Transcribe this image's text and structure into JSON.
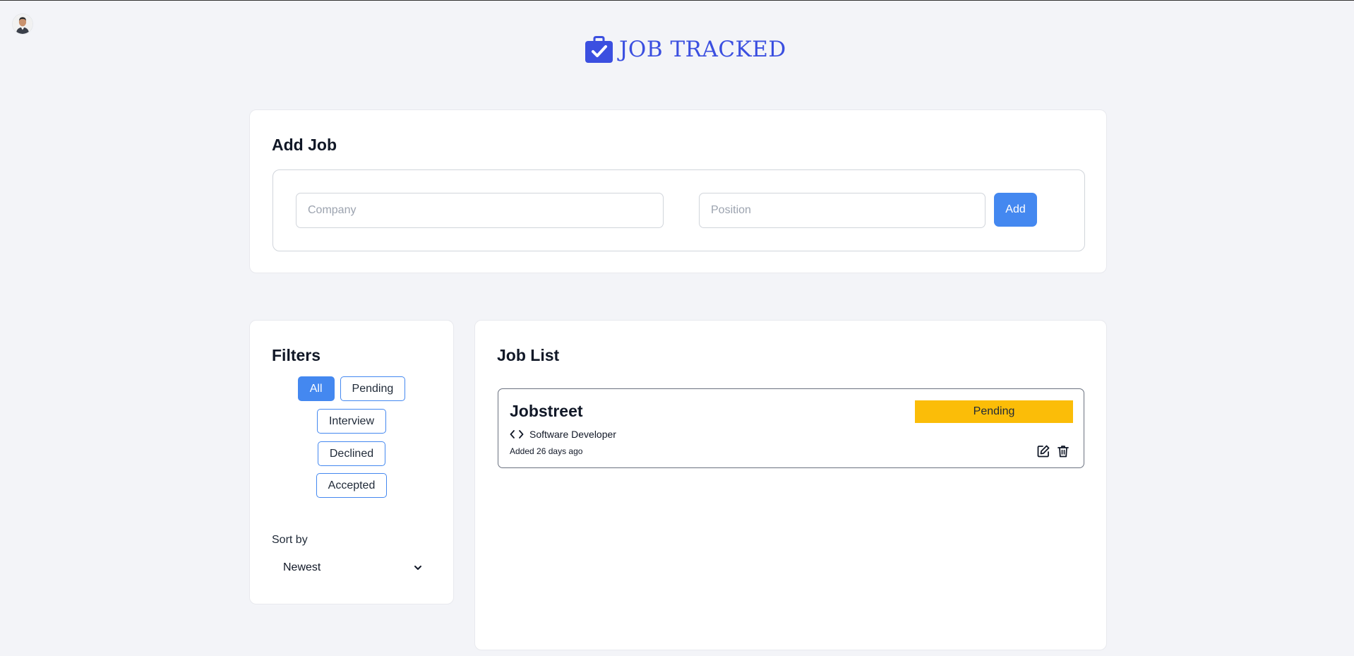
{
  "header": {
    "logo_text": "JOB TRACKED",
    "brand_color": "#3b4fe0",
    "logo_icon": "briefcase-check-icon",
    "avatar": "user-avatar"
  },
  "add_job": {
    "title": "Add Job",
    "company_placeholder": "Company",
    "company_value": "",
    "position_placeholder": "Position",
    "position_value": "",
    "add_label": "Add",
    "accent_color": "#4488f0"
  },
  "filters": {
    "title": "Filters",
    "chips": [
      {
        "label": "All",
        "active": true
      },
      {
        "label": "Pending",
        "active": false
      },
      {
        "label": "Interview",
        "active": false
      },
      {
        "label": "Declined",
        "active": false
      },
      {
        "label": "Accepted",
        "active": false
      }
    ],
    "sort_label": "Sort by",
    "sort_value": "Newest"
  },
  "job_list": {
    "title": "Job List",
    "jobs": [
      {
        "company": "Jobstreet",
        "position": "Software Developer",
        "added": "Added 26 days ago",
        "status": "Pending",
        "status_color": "#fbbd08",
        "position_icon": "code-icon"
      }
    ]
  }
}
